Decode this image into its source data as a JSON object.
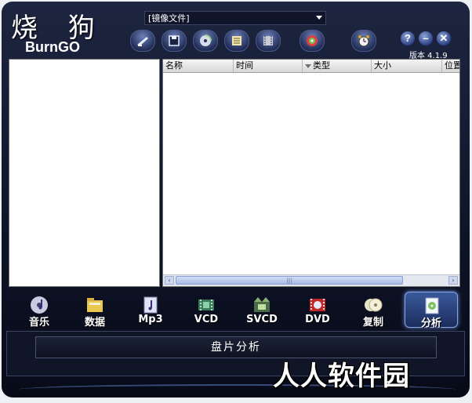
{
  "app": {
    "logo_cn": "烧 狗",
    "logo_en": "BurnGO",
    "version": "版本 4.1.9"
  },
  "toolbar": {
    "image_select": {
      "value": "[镜像文件]"
    },
    "buttons": [
      "quick-burn-icon",
      "save-icon",
      "disc-icon",
      "list-icon",
      "film-icon",
      "settings-disc-icon",
      "alarm-clock-icon"
    ],
    "help_label": "?",
    "minimize_label": "–",
    "close_label": "✕"
  },
  "file_list": {
    "columns": [
      "名称",
      "时间",
      "类型",
      "大小",
      "位置"
    ],
    "grip": "|||"
  },
  "nav": {
    "items": [
      {
        "label": "音乐",
        "icon": "music-disc-icon"
      },
      {
        "label": "数据",
        "icon": "data-folder-icon"
      },
      {
        "label": "Mp3",
        "icon": "mp3-icon"
      },
      {
        "label": "VCD",
        "icon": "vcd-icon"
      },
      {
        "label": "SVCD",
        "icon": "svcd-icon"
      },
      {
        "label": "DVD",
        "icon": "dvd-icon"
      },
      {
        "label": "复制",
        "icon": "copy-disc-icon"
      },
      {
        "label": "分析",
        "icon": "analyze-disc-icon"
      }
    ],
    "active_index": 7
  },
  "analysis": {
    "title": "盘片分析"
  },
  "watermark": "人人软件园"
}
